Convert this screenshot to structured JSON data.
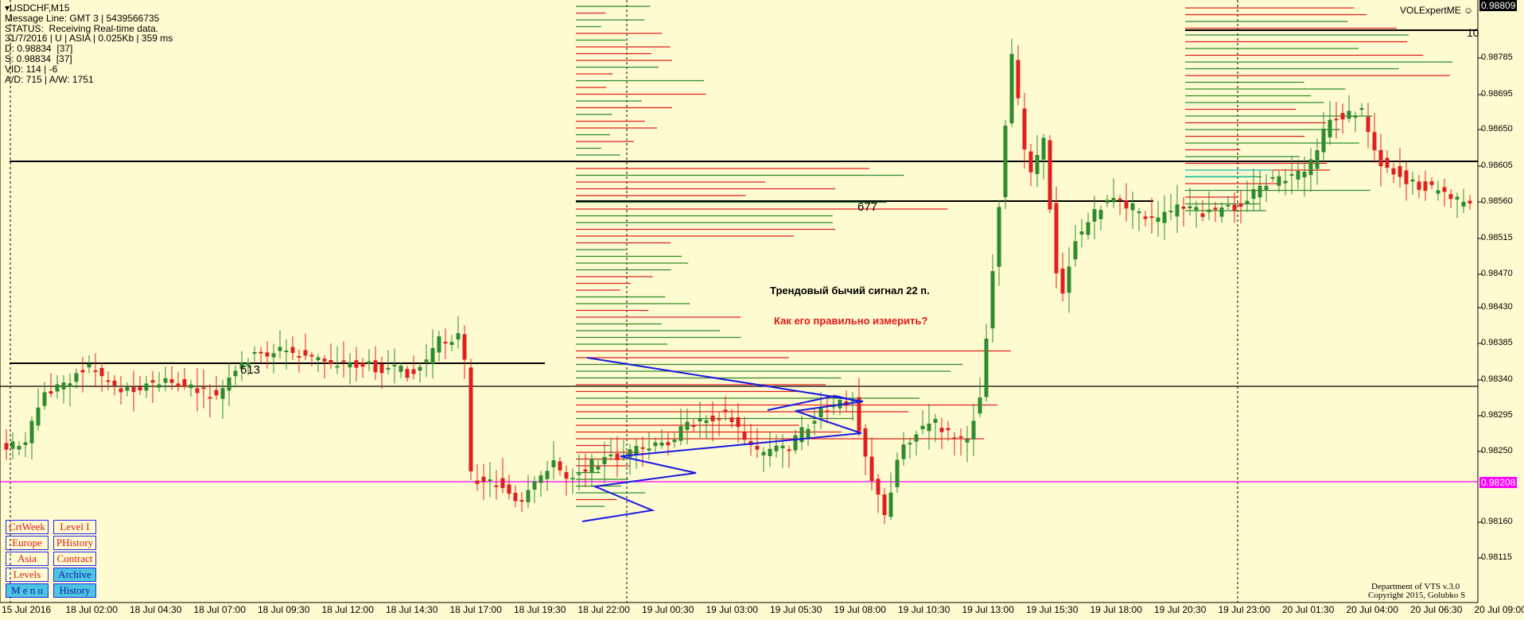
{
  "header": {
    "symbol_line": "USDCHF,M15",
    "lines": [
      "Message Line: GMT 3 | 5439566735",
      "STATUS:  Receiving Real-time data.",
      "31/7/2016 | U | ASIA | 0.025Kb | 359 ms",
      "D: 0.98834  [37]",
      "S: 0.98834  [37]",
      "VID: 114 | -6",
      "A/D: 715 | A/W: 1751"
    ]
  },
  "indicator_name": "VOLExpertME",
  "copyright": [
    "Department of VTS  v.3.0",
    "Copyright 2015, Golubko S"
  ],
  "price_axis": {
    "ticks": [
      "0.98785",
      "0.98695",
      "0.98650",
      "0.98605",
      "0.98560",
      "0.98515",
      "0.98470",
      "0.98430",
      "0.98385",
      "0.98340",
      "0.98295",
      "0.98250",
      "0.98160",
      "0.98115"
    ],
    "top_tag": "0.98809",
    "current_tag": "0.98208",
    "colors": {
      "top_tag_bg": "#000000",
      "current_tag_bg": "#ff00ff"
    }
  },
  "time_axis": [
    "15 Jul 2016",
    "18 Jul 02:00",
    "18 Jul 04:30",
    "18 Jul 07:00",
    "18 Jul 09:30",
    "18 Jul 12:00",
    "18 Jul 14:30",
    "18 Jul 17:00",
    "18 Jul 19:30",
    "18 Jul 22:00",
    "19 Jul 00:30",
    "19 Jul 03:00",
    "19 Jul 05:30",
    "19 Jul 08:00",
    "19 Jul 10:30",
    "19 Jul 13:00",
    "19 Jul 15:30",
    "19 Jul 18:00",
    "19 Jul 20:30",
    "19 Jul 23:00",
    "20 Jul 01:30",
    "20 Jul 04:00",
    "20 Jul 06:30",
    "20 Jul 09:00"
  ],
  "levels": {
    "label_613": "613",
    "label_677": "677",
    "label_top_right": "10"
  },
  "annotations": {
    "signal": "Трендовый бычий сигнал 22 п.",
    "question": "Как его правильно измерить?"
  },
  "buttons": [
    {
      "label": "CrtWeek",
      "filled": false
    },
    {
      "label": "Level I",
      "filled": false
    },
    {
      "label": "Europe",
      "filled": false
    },
    {
      "label": "PHistory",
      "filled": false
    },
    {
      "label": "Asia",
      "filled": false
    },
    {
      "label": "Contract",
      "filled": false
    },
    {
      "label": "Levels",
      "filled": false
    },
    {
      "label": "Archive",
      "filled": true
    },
    {
      "label": "M e n u",
      "filled": true
    },
    {
      "label": "History",
      "filled": true
    }
  ],
  "colors": {
    "bull": "#2e8b2e",
    "bear": "#e02020",
    "level": "#000000",
    "pattern": "#1a1ae0",
    "current_price": "#ff00ff"
  }
}
